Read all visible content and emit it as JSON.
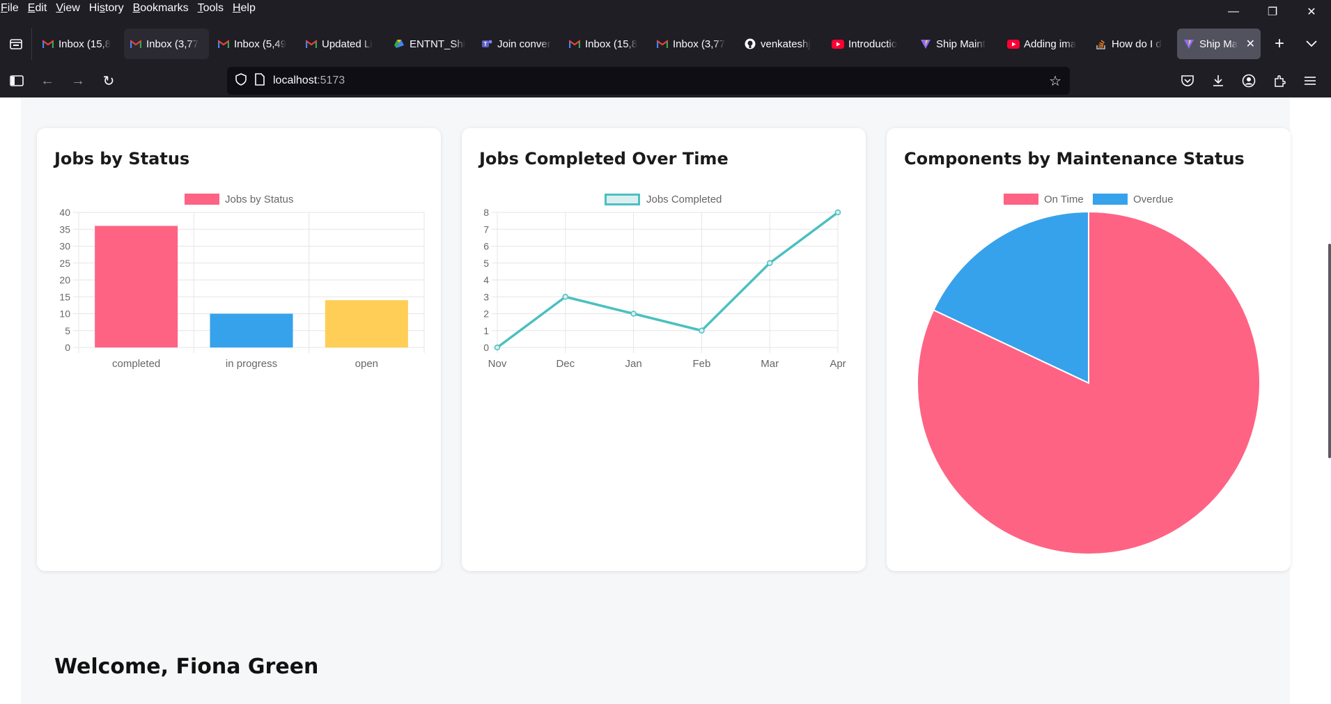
{
  "menu": [
    {
      "accel": "F",
      "rest": "ile"
    },
    {
      "accel": "E",
      "rest": "dit"
    },
    {
      "accel": "V",
      "rest": "iew"
    },
    {
      "accel": "",
      "pre": "Hi",
      "accel2": "s",
      "rest": "tory"
    },
    {
      "accel": "B",
      "rest": "ookmarks"
    },
    {
      "accel": "T",
      "rest": "ools"
    },
    {
      "accel": "H",
      "rest": "elp"
    }
  ],
  "tabs": [
    {
      "title": "Inbox (15,8",
      "icon": "gmail-icon",
      "state": ""
    },
    {
      "title": "Inbox (3,77",
      "icon": "gmail-icon",
      "state": "hover"
    },
    {
      "title": "Inbox (5,49",
      "icon": "gmail-icon",
      "state": ""
    },
    {
      "title": "Updated Li",
      "icon": "gmail-icon",
      "state": ""
    },
    {
      "title": "ENTNT_Shi",
      "icon": "google-drive-icon",
      "state": ""
    },
    {
      "title": "Join conver",
      "icon": "teams-icon",
      "state": ""
    },
    {
      "title": "Inbox (15,8",
      "icon": "gmail-icon",
      "state": ""
    },
    {
      "title": "Inbox (3,77",
      "icon": "gmail-icon",
      "state": ""
    },
    {
      "title": "venkateshj",
      "icon": "github-icon",
      "state": ""
    },
    {
      "title": "Introductio",
      "icon": "youtube-icon",
      "state": ""
    },
    {
      "title": "Ship Maint",
      "icon": "vite-icon",
      "state": ""
    },
    {
      "title": "Adding ima",
      "icon": "youtube-icon",
      "state": ""
    },
    {
      "title": "How do I d",
      "icon": "stackoverflow-icon",
      "state": ""
    },
    {
      "title": "Ship Ma",
      "icon": "vite-icon",
      "state": "active"
    }
  ],
  "url": {
    "host": "localhost",
    "port": ":5173"
  },
  "cards": {
    "status": {
      "title": "Jobs by Status"
    },
    "time": {
      "title": "Jobs Completed Over Time"
    },
    "components": {
      "title": "Components by Maintenance Status"
    }
  },
  "welcome": "Welcome, Fiona Green",
  "colors": {
    "pink": "#ff6384",
    "blue": "#36a2eb",
    "yellow": "#ffce56",
    "teal": "#4bc0c0"
  },
  "chart_data": [
    {
      "type": "bar",
      "title": "Jobs by Status",
      "legend": [
        "Jobs by Status"
      ],
      "legend_position": "top",
      "categories": [
        "completed",
        "in progress",
        "open"
      ],
      "values": [
        36,
        10,
        14
      ],
      "colors": [
        "#ff6384",
        "#36a2eb",
        "#ffce56"
      ],
      "ylim": [
        0,
        40
      ],
      "yticks": [
        0,
        5,
        10,
        15,
        20,
        25,
        30,
        35,
        40
      ],
      "grid": true
    },
    {
      "type": "line",
      "title": "Jobs Completed Over Time",
      "legend": [
        "Jobs Completed"
      ],
      "legend_position": "top",
      "categories": [
        "Nov",
        "Dec",
        "Jan",
        "Feb",
        "Mar",
        "Apr"
      ],
      "series": [
        {
          "name": "Jobs Completed",
          "values": [
            0,
            3,
            2,
            1,
            5,
            8
          ]
        }
      ],
      "color": "#4bc0c0",
      "ylim": [
        0,
        8
      ],
      "yticks": [
        0,
        1,
        2,
        3,
        4,
        5,
        6,
        7,
        8
      ],
      "grid": true
    },
    {
      "type": "pie",
      "title": "Components by Maintenance Status",
      "legend": [
        "On Time",
        "Overdue"
      ],
      "legend_position": "top",
      "labels": [
        "On Time",
        "Overdue"
      ],
      "values": [
        82,
        18
      ],
      "colors": [
        "#ff6384",
        "#36a2eb"
      ]
    }
  ]
}
